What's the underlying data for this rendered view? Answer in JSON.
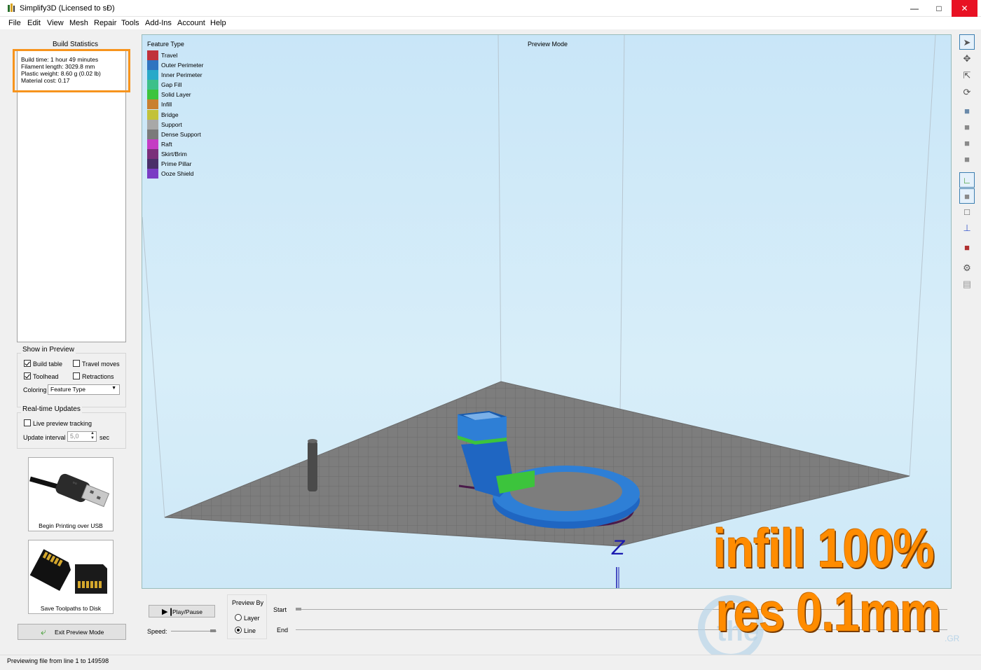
{
  "window": {
    "title": "Simplify3D (Licensed to sƉ)",
    "minimize": "—",
    "maximize": "□",
    "close": "✕"
  },
  "menu": [
    "File",
    "Edit",
    "View",
    "Mesh",
    "Repair",
    "Tools",
    "Add-Ins",
    "Account",
    "Help"
  ],
  "left_panel": {
    "build_stats_title": "Build Statistics",
    "stats": [
      "Build time: 1 hour 49 minutes",
      "Filament length: 3029.8 mm",
      "Plastic weight: 8.60 g (0.02 lb)",
      "Material cost: 0.17"
    ],
    "show_in_preview": {
      "title": "Show in Preview",
      "build_table": {
        "label": "Build table",
        "checked": true
      },
      "travel_moves": {
        "label": "Travel moves",
        "checked": false
      },
      "toolhead": {
        "label": "Toolhead",
        "checked": true
      },
      "retractions": {
        "label": "Retractions",
        "checked": false
      },
      "coloring_label": "Coloring",
      "coloring_value": "Feature Type"
    },
    "realtime": {
      "title": "Real-time Updates",
      "live_tracking": {
        "label": "Live preview tracking",
        "checked": false
      },
      "interval_label": "Update interval",
      "interval_value": "5,0",
      "interval_unit": "sec"
    },
    "usb_button": "Begin Printing over USB",
    "disk_button": "Save Toolpaths to Disk",
    "exit_button": "Exit Preview Mode"
  },
  "viewport": {
    "preview_mode_label": "Preview Mode",
    "legend_title": "Feature Type",
    "legend": [
      {
        "label": "Travel",
        "color": "#c0313a"
      },
      {
        "label": "Outer Perimeter",
        "color": "#2f74c0"
      },
      {
        "label": "Inner Perimeter",
        "color": "#28a9c9"
      },
      {
        "label": "Gap Fill",
        "color": "#3cc08a"
      },
      {
        "label": "Solid Layer",
        "color": "#3cc43c"
      },
      {
        "label": "Infill",
        "color": "#c9802f"
      },
      {
        "label": "Bridge",
        "color": "#c2c23a"
      },
      {
        "label": "Support",
        "color": "#a8a8a8"
      },
      {
        "label": "Dense Support",
        "color": "#7a7a7a"
      },
      {
        "label": "Raft",
        "color": "#c43cc4"
      },
      {
        "label": "Skirt/Brim",
        "color": "#7a2f7a"
      },
      {
        "label": "Prime Pillar",
        "color": "#4a2f6a"
      },
      {
        "label": "Ooze Shield",
        "color": "#7a3cc4"
      }
    ],
    "axis_z": "Z"
  },
  "bottom": {
    "play_pause": "Play/Pause",
    "speed_label": "Speed:",
    "preview_by_title": "Preview By",
    "layer_option": "Layer",
    "line_option": "Line",
    "selected": "Line",
    "start_label": "Start",
    "end_label": "End"
  },
  "status": "Previewing file from line 1 to 149598",
  "overlay": {
    "line1": "infill 100%",
    "line2": "res 0.1mm",
    "watermark_gr": ".GR",
    "color": "#ff8c00"
  }
}
